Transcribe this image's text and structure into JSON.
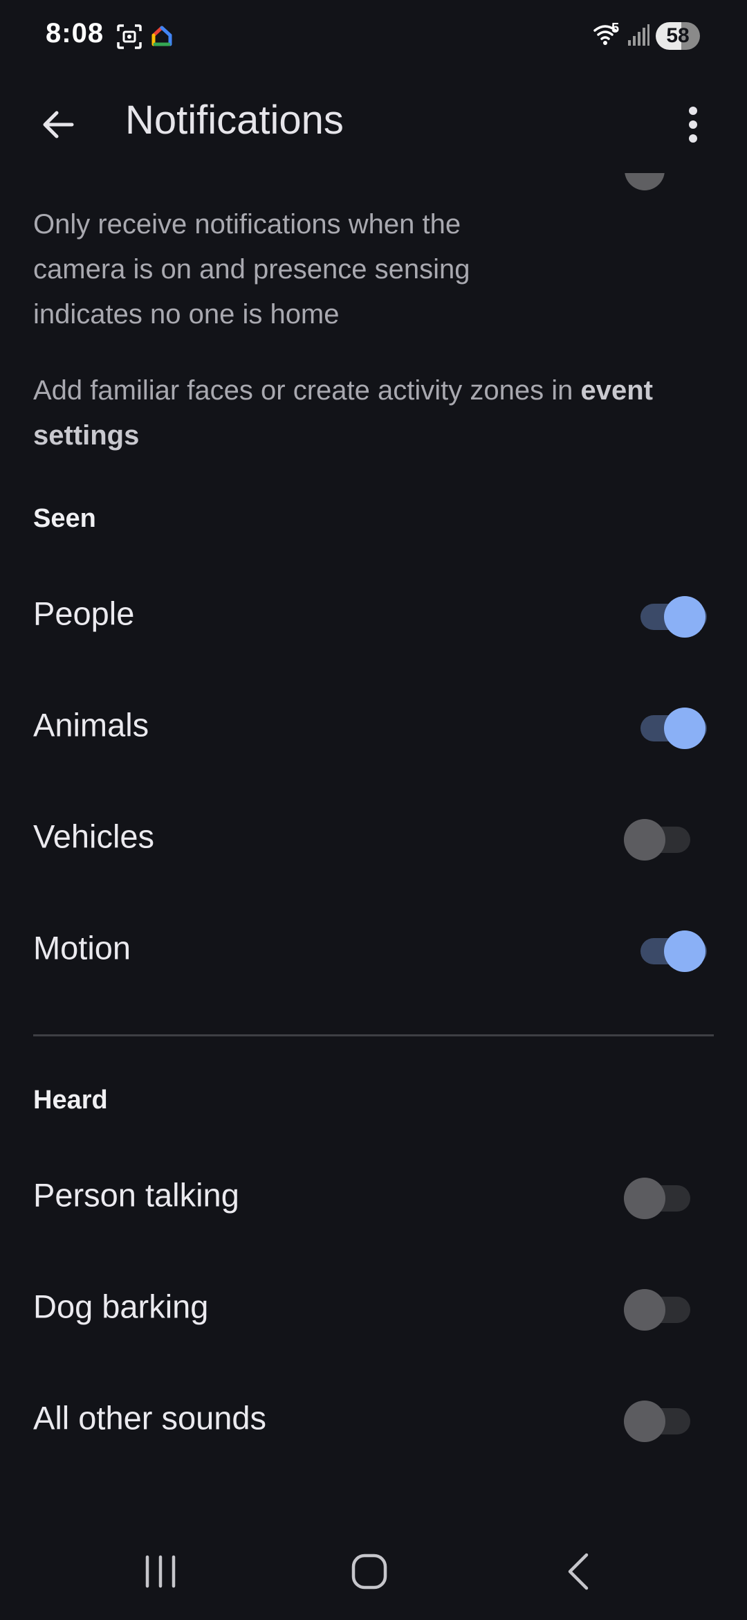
{
  "status_bar": {
    "time": "8:08",
    "wifi_label": "5",
    "battery_level": "58"
  },
  "app_bar": {
    "title": "Notifications"
  },
  "content": {
    "description": "Only receive notifications when the camera is on and presence sensing indicates no one is home",
    "hint_prefix": "Add familiar faces or create activity zones in ",
    "hint_link": "event settings",
    "seen_header": "Seen",
    "seen_items": [
      {
        "label": "People",
        "on": true
      },
      {
        "label": "Animals",
        "on": true
      },
      {
        "label": "Vehicles",
        "on": false
      },
      {
        "label": "Motion",
        "on": true
      }
    ],
    "heard_header": "Heard",
    "heard_items": [
      {
        "label": "Person talking",
        "on": false
      },
      {
        "label": "Dog barking",
        "on": false
      },
      {
        "label": "All other sounds",
        "on": false
      }
    ]
  },
  "colors": {
    "background": "#121318",
    "accent": "#8ab0f6",
    "track_on": "#3b4a68",
    "thumb_off": "#5c5c60"
  }
}
